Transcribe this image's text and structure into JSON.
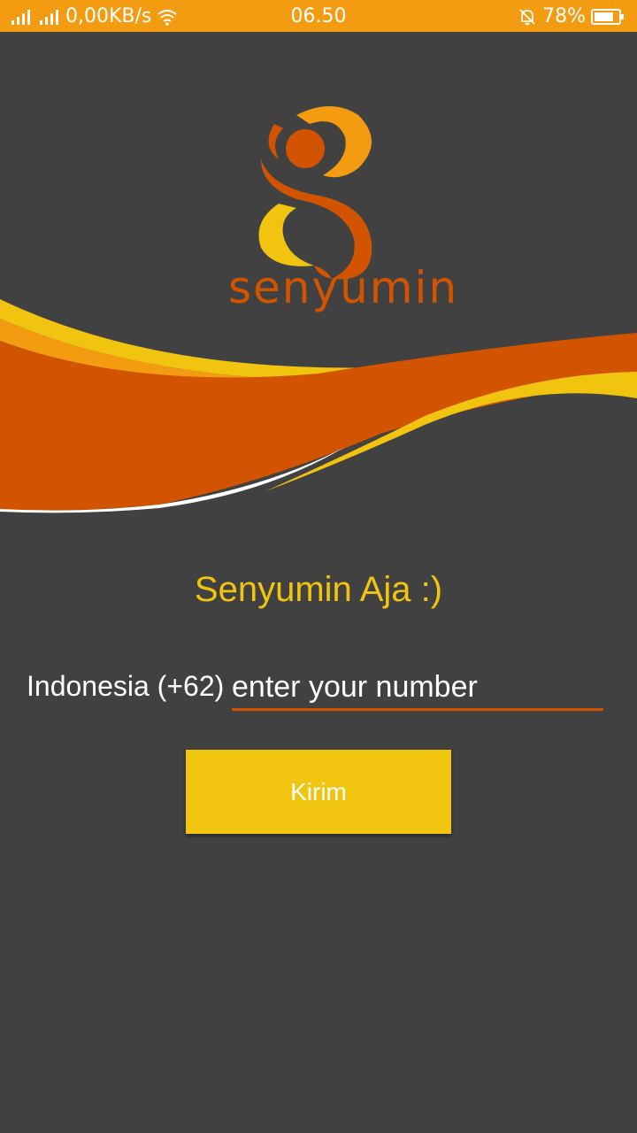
{
  "status_bar": {
    "network_speed": "0,00KB/s",
    "time": "06.50",
    "battery_percent": "78%",
    "icons": [
      "signal-icon",
      "signal-icon",
      "wifi-icon",
      "bell-muted-icon",
      "battery-icon"
    ]
  },
  "logo": {
    "wordmark": "senyumin"
  },
  "main": {
    "tagline": "Senyumin Aja :)",
    "country_code_label": "Indonesia (+62)",
    "phone_placeholder": "enter your number",
    "phone_value": "",
    "send_button_label": "Kirim"
  },
  "colors": {
    "status_bar": "#F39C12",
    "background": "#414141",
    "accent_orange": "#D35400",
    "accent_yellow": "#F1C40F",
    "accent_light_orange": "#F39C12"
  }
}
